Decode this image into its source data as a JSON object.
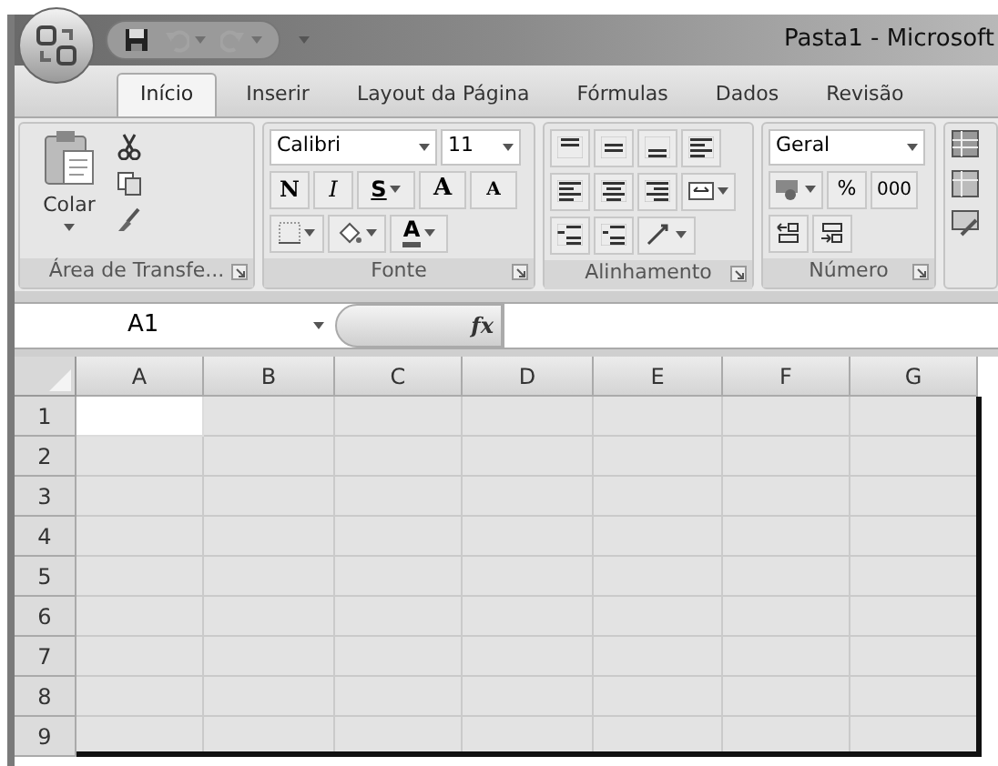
{
  "window": {
    "title": "Pasta1 - Microsoft"
  },
  "quick_access": [
    {
      "kind": "save",
      "disabled": false
    },
    {
      "kind": "undo",
      "disabled": true
    },
    {
      "kind": "redo",
      "disabled": true
    }
  ],
  "tabs": [
    {
      "label": "Início",
      "selected": true
    },
    {
      "label": "Inserir",
      "selected": false
    },
    {
      "label": "Layout da Página",
      "selected": false
    },
    {
      "label": "Fórmulas",
      "selected": false
    },
    {
      "label": "Dados",
      "selected": false
    },
    {
      "label": "Revisão",
      "selected": false
    }
  ],
  "clipboard": {
    "label": "Área de Transfe...",
    "paste": "Colar"
  },
  "font": {
    "label": "Fonte",
    "name": "Calibri",
    "size": "11",
    "bold": "N",
    "italic": "I",
    "underline": "S",
    "grow": "A",
    "shrink": "A",
    "font_color_letter": "A"
  },
  "alignment": {
    "label": "Alinhamento"
  },
  "number": {
    "label": "Número",
    "format": "Geral",
    "percent": "%",
    "thousands": "000"
  },
  "formula_bar": {
    "name_box": "A1",
    "fx": "fx"
  },
  "grid": {
    "columns": [
      "A",
      "B",
      "C",
      "D",
      "E",
      "F",
      "G"
    ],
    "rows": [
      {
        "label": "1",
        "cells": [
          {
            "active": true
          },
          {
            "active": false
          },
          {
            "active": false
          },
          {
            "active": false
          },
          {
            "active": false
          },
          {
            "active": false
          },
          {
            "active": false
          }
        ]
      },
      {
        "label": "2",
        "cells": [
          {
            "active": false
          },
          {
            "active": false
          },
          {
            "active": false
          },
          {
            "active": false
          },
          {
            "active": false
          },
          {
            "active": false
          },
          {
            "active": false
          }
        ]
      },
      {
        "label": "3",
        "cells": [
          {
            "active": false
          },
          {
            "active": false
          },
          {
            "active": false
          },
          {
            "active": false
          },
          {
            "active": false
          },
          {
            "active": false
          },
          {
            "active": false
          }
        ]
      },
      {
        "label": "4",
        "cells": [
          {
            "active": false
          },
          {
            "active": false
          },
          {
            "active": false
          },
          {
            "active": false
          },
          {
            "active": false
          },
          {
            "active": false
          },
          {
            "active": false
          }
        ]
      },
      {
        "label": "5",
        "cells": [
          {
            "active": false
          },
          {
            "active": false
          },
          {
            "active": false
          },
          {
            "active": false
          },
          {
            "active": false
          },
          {
            "active": false
          },
          {
            "active": false
          }
        ]
      },
      {
        "label": "6",
        "cells": [
          {
            "active": false
          },
          {
            "active": false
          },
          {
            "active": false
          },
          {
            "active": false
          },
          {
            "active": false
          },
          {
            "active": false
          },
          {
            "active": false
          }
        ]
      },
      {
        "label": "7",
        "cells": [
          {
            "active": false
          },
          {
            "active": false
          },
          {
            "active": false
          },
          {
            "active": false
          },
          {
            "active": false
          },
          {
            "active": false
          },
          {
            "active": false
          }
        ]
      },
      {
        "label": "8",
        "cells": [
          {
            "active": false
          },
          {
            "active": false
          },
          {
            "active": false
          },
          {
            "active": false
          },
          {
            "active": false
          },
          {
            "active": false
          },
          {
            "active": false
          }
        ]
      },
      {
        "label": "9",
        "cells": [
          {
            "active": false
          },
          {
            "active": false
          },
          {
            "active": false
          },
          {
            "active": false
          },
          {
            "active": false
          },
          {
            "active": false
          },
          {
            "active": false
          }
        ]
      }
    ]
  }
}
